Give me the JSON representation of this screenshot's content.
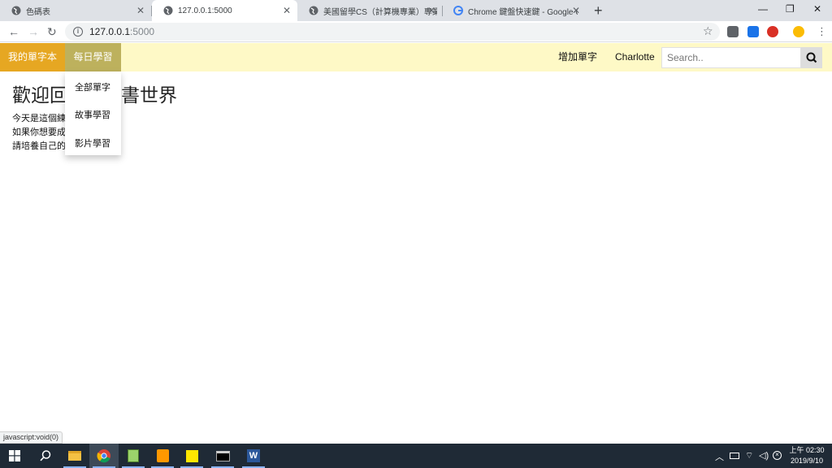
{
  "browser": {
    "tabs": [
      {
        "title": "色碼表",
        "active": false
      },
      {
        "title": "127.0.0.1:5000",
        "active": true
      },
      {
        "title": "美國留學CS（計算機專業）專業",
        "active": false
      },
      {
        "title": "Chrome 鍵盤快速鍵 - Google Ch",
        "active": false
      }
    ],
    "new_tab": "+",
    "url_host": "127.0.0.1",
    "url_port": ":5000",
    "status_url": "javascript:void(0)"
  },
  "navbar": {
    "brand": "我的單字本",
    "daily": "每日學習",
    "add_word": "增加單字",
    "user": "Charlotte",
    "search_placeholder": "Search.."
  },
  "dropdown": {
    "items": [
      "全部單字",
      "故事學習",
      "影片學習"
    ]
  },
  "content": {
    "title_left": "歡迎回",
    "title_right": "書世界",
    "lines": [
      "今天是這個練",
      "如果你想要成",
      "請培養自己的"
    ]
  },
  "taskbar": {
    "time": "上午 02:30",
    "date": "2019/9/10"
  },
  "colors": {
    "navbar_bg": "#fef9c6",
    "brand_bg": "#e6a722",
    "daily_bg": "#bdb15d",
    "taskbar_bg": "#1f2a36"
  }
}
